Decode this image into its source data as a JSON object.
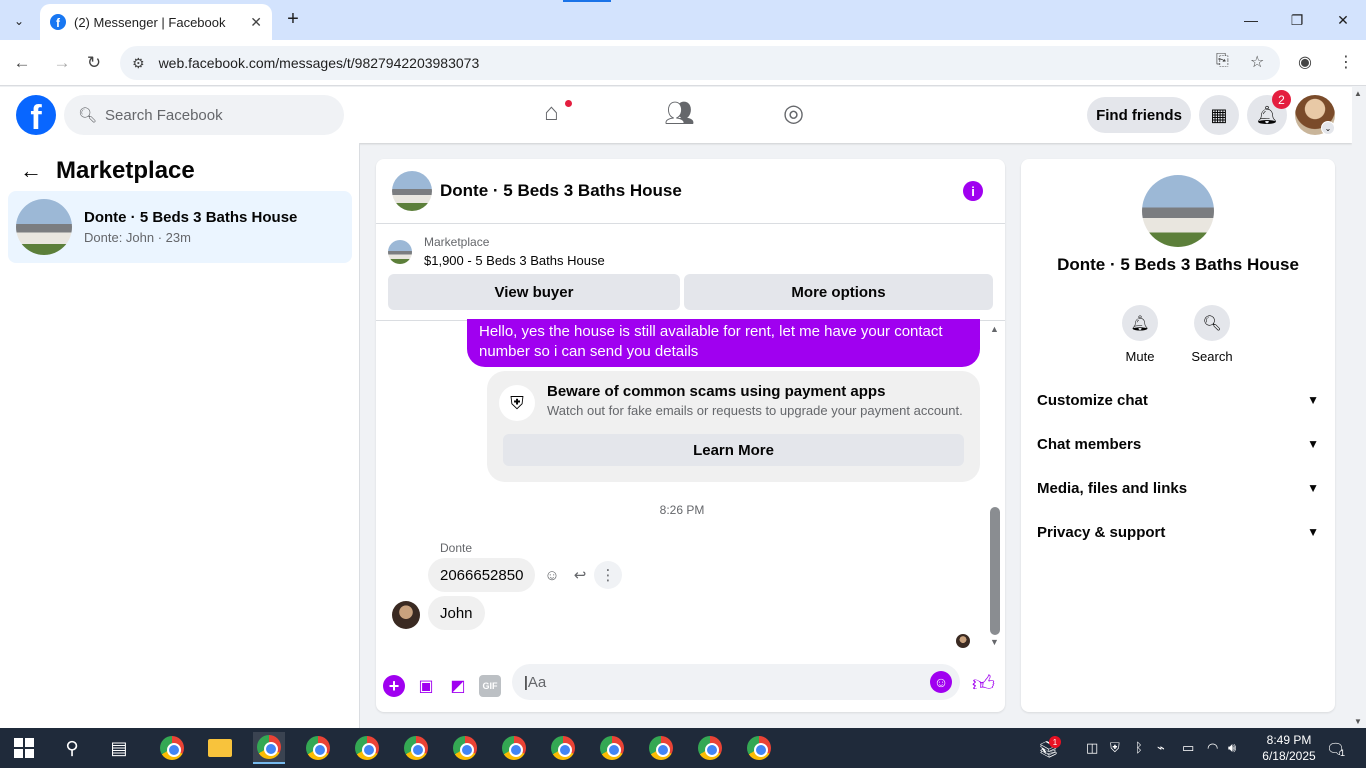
{
  "browser": {
    "tab_title": "(2) Messenger | Facebook",
    "favicon": "f",
    "url": "web.facebook.com/messages/t/9827942203983073"
  },
  "fb_header": {
    "logo": "f",
    "search_placeholder": "Search Facebook",
    "find_friends": "Find friends",
    "notification_count": "2"
  },
  "sidebar": {
    "title": "Marketplace",
    "conversations": [
      {
        "name": "Donte · 5 Beds 3 Baths House",
        "preview": "Donte: John · 23m"
      }
    ]
  },
  "chat": {
    "title": "Donte · 5 Beds 3 Baths House",
    "marketplace_label": "Marketplace",
    "listing": "$1,900 - 5 Beds 3 Baths House",
    "view_buyer": "View buyer",
    "more_options": "More options",
    "outgoing_message": "Hello, yes the house is still available for rent, let me have your contact number so i can send you  details",
    "scam_title": "Beware of common scams using payment apps",
    "scam_text": "Watch out for fake emails or requests to upgrade your payment account.",
    "learn_more": "Learn More",
    "timestamp": "8:26 PM",
    "sender": "Donte",
    "messages": [
      "2066652850",
      "John"
    ],
    "composer_placeholder": "Aa"
  },
  "details": {
    "name": "Donte · 5 Beds 3 Baths House",
    "mute": "Mute",
    "search": "Search",
    "sections": [
      "Customize chat",
      "Chat members",
      "Media, files and links",
      "Privacy & support"
    ]
  },
  "taskbar": {
    "time": "8:49 PM",
    "date": "6/18/2025",
    "tray_badge": "1",
    "notification_count": "1"
  },
  "colors": {
    "accent": "#a000f0",
    "fb_blue": "#0866ff",
    "badge_red": "#e41e3f"
  }
}
